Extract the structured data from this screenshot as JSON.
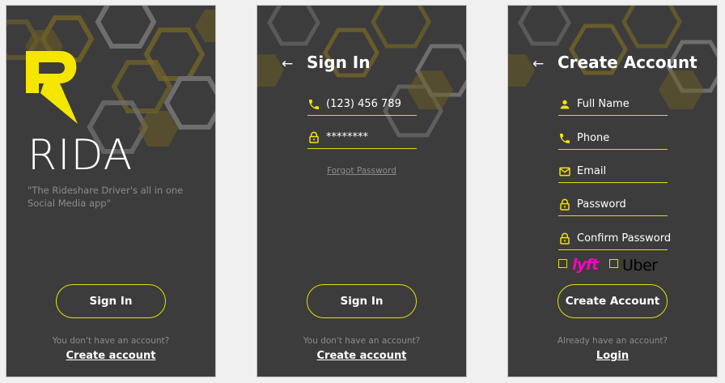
{
  "colors": {
    "accent": "#e1e000",
    "background": "#3c3c3c",
    "muted": "#8c8c8c",
    "lyft": "#ff00bf"
  },
  "splash": {
    "brand": "RIDA",
    "tagline": "\"The Rideshare Driver's all in one Social Media app\"",
    "signin_label": "Sign In",
    "hint": "You don't have an account?",
    "create_link": "Create account"
  },
  "signin": {
    "back_icon": "←",
    "title": "Sign In",
    "phone_icon": "phone-icon",
    "phone_value": "(123) 456 789",
    "lock_icon": "lock-icon",
    "password_value": "********",
    "forgot": "Forgot Password",
    "signin_label": "Sign In",
    "hint": "You don't have an account?",
    "create_link": "Create account"
  },
  "create": {
    "back_icon": "←",
    "title": "Create Account",
    "fields": [
      {
        "icon": "person-icon",
        "placeholder": "Full Name"
      },
      {
        "icon": "phone-icon",
        "placeholder": "Phone"
      },
      {
        "icon": "mail-icon",
        "placeholder": "Email"
      },
      {
        "icon": "lock-icon",
        "placeholder": "Password"
      },
      {
        "icon": "lock-icon",
        "placeholder": "Confirm Password"
      }
    ],
    "options": [
      {
        "label": "lyft",
        "checked": false
      },
      {
        "label": "Uber",
        "checked": false
      }
    ],
    "create_label": "Create Account",
    "hint": "Already have an account?",
    "login_link": "Login"
  }
}
